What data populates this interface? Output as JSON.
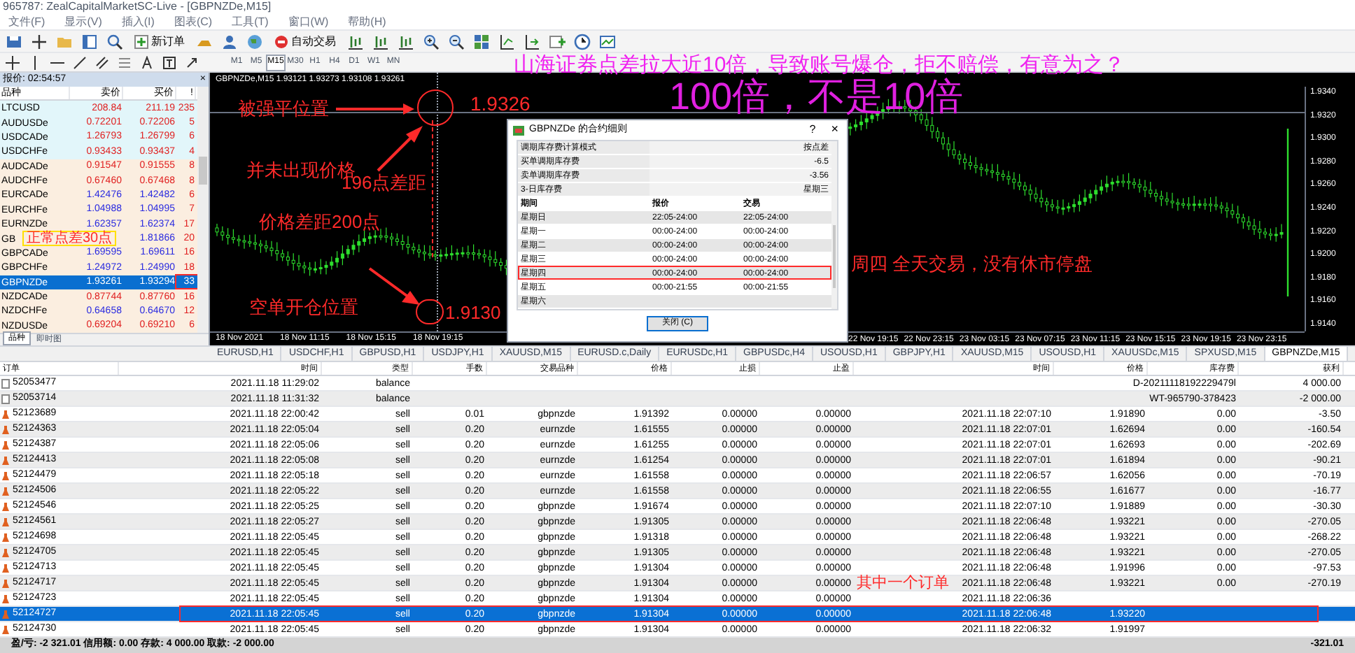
{
  "window": {
    "title": "965787: ZealCapitalMarketSC-Live - [GBPNZDe,M15]"
  },
  "menu": [
    "文件(F)",
    "显示(V)",
    "插入(I)",
    "图表(C)",
    "工具(T)",
    "窗口(W)",
    "帮助(H)"
  ],
  "toolbar": {
    "new_order": "新订单",
    "auto_trading": "自动交易"
  },
  "timeframes": [
    {
      "label": "M1",
      "selected": false
    },
    {
      "label": "M5",
      "selected": false
    },
    {
      "label": "M15",
      "selected": true
    },
    {
      "label": "M30",
      "selected": false
    },
    {
      "label": "H1",
      "selected": false
    },
    {
      "label": "H4",
      "selected": false
    },
    {
      "label": "D1",
      "selected": false
    },
    {
      "label": "W1",
      "selected": false
    },
    {
      "label": "MN",
      "selected": false
    }
  ],
  "market_watch": {
    "title": "报价: 02:54:57",
    "columns": [
      "品种",
      "卖价",
      "买价",
      "!"
    ],
    "rows": [
      {
        "symbol": "LTCUSD",
        "bid": "208.84",
        "ask": "211.19",
        "spread": "235",
        "color": "#e02020",
        "selected": false
      },
      {
        "symbol": "AUDUSDe",
        "bid": "0.72201",
        "ask": "0.72206",
        "spread": "5",
        "color": "#e02020",
        "selected": false
      },
      {
        "symbol": "USDCADe",
        "bid": "1.26793",
        "ask": "1.26799",
        "spread": "6",
        "color": "#e02020",
        "selected": false
      },
      {
        "symbol": "USDCHFe",
        "bid": "0.93433",
        "ask": "0.93437",
        "spread": "4",
        "color": "#e02020",
        "selected": false
      },
      {
        "symbol": "AUDCADe",
        "bid": "0.91547",
        "ask": "0.91555",
        "spread": "8",
        "color": "#e02020",
        "selected": false
      },
      {
        "symbol": "AUDCHFe",
        "bid": "0.67460",
        "ask": "0.67468",
        "spread": "8",
        "color": "#e02020",
        "selected": false
      },
      {
        "symbol": "EURCADe",
        "bid": "1.42476",
        "ask": "1.42482",
        "spread": "6",
        "color": "#2a2ae0",
        "selected": false
      },
      {
        "symbol": "EURCHFe",
        "bid": "1.04988",
        "ask": "1.04995",
        "spread": "7",
        "color": "#2a2ae0",
        "selected": false
      },
      {
        "symbol": "EURNZDe",
        "bid": "1.62357",
        "ask": "1.62374",
        "spread": "17",
        "color": "#2a2ae0",
        "selected": false
      },
      {
        "symbol": "GB",
        "ask": "1.81866",
        "spread": "20",
        "color": "#2a2ae0",
        "selected": false
      },
      {
        "symbol": "GBPCADe",
        "bid": "1.69595",
        "ask": "1.69611",
        "spread": "16",
        "color": "#2a2ae0",
        "selected": false
      },
      {
        "symbol": "GBPCHFe",
        "bid": "1.24972",
        "ask": "1.24990",
        "spread": "18",
        "color": "#2a2ae0",
        "selected": false
      },
      {
        "symbol": "GBPNZDe",
        "bid": "1.93261",
        "ask": "1.93294",
        "spread": "33",
        "selected": true
      },
      {
        "symbol": "NZDCADe",
        "bid": "0.87744",
        "ask": "0.87760",
        "spread": "16",
        "color": "#e02020",
        "selected": false
      },
      {
        "symbol": "NZDCHFe",
        "bid": "0.64658",
        "ask": "0.64670",
        "spread": "12",
        "color": "#2a2ae0",
        "selected": false
      },
      {
        "symbol": "NZDUSDe",
        "bid": "0.69204",
        "ask": "0.69210",
        "spread": "6",
        "color": "#e02020",
        "selected": false
      }
    ],
    "tabs": [
      {
        "label": "品种",
        "selected": true
      },
      {
        "label": "即时图",
        "selected": false
      }
    ]
  },
  "chart": {
    "header": "GBPNZDe,M15  1.93121 1.93273 1.93108 1.93261",
    "price_labels": [
      "1.9340",
      "1.9320",
      "1.9300",
      "1.9280",
      "1.9260",
      "1.9240",
      "1.9220",
      "1.9200",
      "1.9180",
      "1.9160",
      "1.9140"
    ],
    "time_labels_left": [
      "18 Nov 2021",
      "18 Nov 11:15",
      "18 Nov 15:15",
      "18 Nov 19:15"
    ],
    "time_labels_right": [
      "22 Nov 19:15",
      "22 Nov 23:15",
      "23 Nov 03:15",
      "23 Nov 07:15",
      "23 Nov 11:15",
      "23 Nov 15:15",
      "23 Nov 19:15",
      "23 Nov 23:15"
    ]
  },
  "dialog": {
    "title": "GBPNZDe 的合约细则",
    "help": "?",
    "close": "×",
    "properties": [
      {
        "name": "调期库存费计算模式",
        "value": "按点差"
      },
      {
        "name": "买单调期库存费",
        "value": "-6.5"
      },
      {
        "name": "卖单调期库存费",
        "value": "-3.56"
      },
      {
        "name": "3-日库存费",
        "value": "星期三"
      }
    ],
    "schedule_columns": [
      "期间",
      "报价",
      "交易"
    ],
    "schedule": [
      {
        "day": "星期日",
        "quote": "22:05-24:00",
        "trade": "22:05-24:00"
      },
      {
        "day": "星期一",
        "quote": "00:00-24:00",
        "trade": "00:00-24:00"
      },
      {
        "day": "星期二",
        "quote": "00:00-24:00",
        "trade": "00:00-24:00"
      },
      {
        "day": "星期三",
        "quote": "00:00-24:00",
        "trade": "00:00-24:00"
      },
      {
        "day": "星期四",
        "quote": "00:00-24:00",
        "trade": "00:00-24:00"
      },
      {
        "day": "星期五",
        "quote": "00:00-21:55",
        "trade": "00:00-21:55"
      },
      {
        "day": "星期六"
      }
    ],
    "button": "关闭 (C)"
  },
  "chart_tabs": [
    {
      "label": "EURUSD,H1",
      "selected": false
    },
    {
      "label": "USDCHF,H1",
      "selected": false
    },
    {
      "label": "GBPUSD,H1",
      "selected": false
    },
    {
      "label": "USDJPY,H1",
      "selected": false
    },
    {
      "label": "XAUUSD,M15",
      "selected": false
    },
    {
      "label": "EURUSD.c,Daily",
      "selected": false
    },
    {
      "label": "EURUSDc,H1",
      "selected": false
    },
    {
      "label": "GBPUSDc,H4",
      "selected": false
    },
    {
      "label": "USOUSD,H1",
      "selected": false
    },
    {
      "label": "GBPJPY,H1",
      "selected": false
    },
    {
      "label": "XAUUSD,M15",
      "selected": false
    },
    {
      "label": "USOUSD,H1",
      "selected": false
    },
    {
      "label": "XAUUSDc,M15",
      "selected": false
    },
    {
      "label": "SPXUSD,M15",
      "selected": false
    },
    {
      "label": "GBPNZDe,M15",
      "selected": true
    }
  ],
  "history": {
    "columns": [
      "订单",
      "时间",
      "类型",
      "手数",
      "交易品种",
      "价格",
      "止损",
      "止盈",
      "时间",
      "价格",
      "库存费",
      "获利"
    ],
    "rows": [
      {
        "kind": "balance",
        "order": "52053477",
        "time": "2021.11.18 11:29:02",
        "type": "balance",
        "comment": "D-20211118192229479l",
        "profit": "4 000.00",
        "selected": false
      },
      {
        "kind": "balance",
        "order": "52053714",
        "time": "2021.11.18 11:31:32",
        "type": "balance",
        "comment": "WT-965790-378423",
        "profit": "-2 000.00",
        "selected": false
      },
      {
        "kind": "trade",
        "order": "52123689",
        "time": "2021.11.18 22:00:42",
        "type": "sell",
        "lots": "0.01",
        "symbol": "gbpnzde",
        "price": "1.91392",
        "sl": "0.00000",
        "tp": "0.00000",
        "close_time": "2021.11.18 22:07:10",
        "close_price": "1.91890",
        "swap": "0.00",
        "profit": "-3.50",
        "selected": false
      },
      {
        "kind": "trade",
        "order": "52124363",
        "time": "2021.11.18 22:05:04",
        "type": "sell",
        "lots": "0.20",
        "symbol": "eurnzde",
        "price": "1.61555",
        "sl": "0.00000",
        "tp": "0.00000",
        "close_time": "2021.11.18 22:07:01",
        "close_price": "1.62694",
        "swap": "0.00",
        "profit": "-160.54",
        "selected": false
      },
      {
        "kind": "trade",
        "order": "52124387",
        "time": "2021.11.18 22:05:06",
        "type": "sell",
        "lots": "0.20",
        "symbol": "eurnzde",
        "price": "1.61255",
        "sl": "0.00000",
        "tp": "0.00000",
        "close_time": "2021.11.18 22:07:01",
        "close_price": "1.62693",
        "swap": "0.00",
        "profit": "-202.69",
        "selected": false
      },
      {
        "kind": "trade",
        "order": "52124413",
        "time": "2021.11.18 22:05:08",
        "type": "sell",
        "lots": "0.20",
        "symbol": "eurnzde",
        "price": "1.61254",
        "sl": "0.00000",
        "tp": "0.00000",
        "close_time": "2021.11.18 22:07:01",
        "close_price": "1.61894",
        "swap": "0.00",
        "profit": "-90.21",
        "selected": false
      },
      {
        "kind": "trade",
        "order": "52124479",
        "time": "2021.11.18 22:05:18",
        "type": "sell",
        "lots": "0.20",
        "symbol": "eurnzde",
        "price": "1.61558",
        "sl": "0.00000",
        "tp": "0.00000",
        "close_time": "2021.11.18 22:06:57",
        "close_price": "1.62056",
        "swap": "0.00",
        "profit": "-70.19",
        "selected": false
      },
      {
        "kind": "trade",
        "order": "52124506",
        "time": "2021.11.18 22:05:22",
        "type": "sell",
        "lots": "0.20",
        "symbol": "eurnzde",
        "price": "1.61558",
        "sl": "0.00000",
        "tp": "0.00000",
        "close_time": "2021.11.18 22:06:55",
        "close_price": "1.61677",
        "swap": "0.00",
        "profit": "-16.77",
        "selected": false
      },
      {
        "kind": "trade",
        "order": "52124546",
        "time": "2021.11.18 22:05:25",
        "type": "sell",
        "lots": "0.20",
        "symbol": "gbpnzde",
        "price": "1.91674",
        "sl": "0.00000",
        "tp": "0.00000",
        "close_time": "2021.11.18 22:07:10",
        "close_price": "1.91889",
        "swap": "0.00",
        "profit": "-30.30",
        "selected": false
      },
      {
        "kind": "trade",
        "order": "52124561",
        "time": "2021.11.18 22:05:27",
        "type": "sell",
        "lots": "0.20",
        "symbol": "gbpnzde",
        "price": "1.91305",
        "sl": "0.00000",
        "tp": "0.00000",
        "close_time": "2021.11.18 22:06:48",
        "close_price": "1.93221",
        "swap": "0.00",
        "profit": "-270.05",
        "selected": false
      },
      {
        "kind": "trade",
        "order": "52124698",
        "time": "2021.11.18 22:05:45",
        "type": "sell",
        "lots": "0.20",
        "symbol": "gbpnzde",
        "price": "1.91318",
        "sl": "0.00000",
        "tp": "0.00000",
        "close_time": "2021.11.18 22:06:48",
        "close_price": "1.93221",
        "swap": "0.00",
        "profit": "-268.22",
        "selected": false
      },
      {
        "kind": "trade",
        "order": "52124705",
        "time": "2021.11.18 22:05:45",
        "type": "sell",
        "lots": "0.20",
        "symbol": "gbpnzde",
        "price": "1.91305",
        "sl": "0.00000",
        "tp": "0.00000",
        "close_time": "2021.11.18 22:06:48",
        "close_price": "1.93221",
        "swap": "0.00",
        "profit": "-270.05",
        "selected": false
      },
      {
        "kind": "trade",
        "order": "52124713",
        "time": "2021.11.18 22:05:45",
        "type": "sell",
        "lots": "0.20",
        "symbol": "gbpnzde",
        "price": "1.91304",
        "sl": "0.00000",
        "tp": "0.00000",
        "close_time": "2021.11.18 22:06:48",
        "close_price": "1.91996",
        "swap": "0.00",
        "profit": "-97.53",
        "selected": false
      },
      {
        "kind": "trade",
        "order": "52124717",
        "time": "2021.11.18 22:05:45",
        "type": "sell",
        "lots": "0.20",
        "symbol": "gbpnzde",
        "price": "1.91304",
        "sl": "0.00000",
        "tp": "0.00000",
        "close_time": "2021.11.18 22:06:48",
        "close_price": "1.93221",
        "swap": "0.00",
        "profit": "-270.19",
        "selected": false
      },
      {
        "kind": "trade",
        "order": "52124723",
        "time": "2021.11.18 22:05:45",
        "type": "sell",
        "lots": "0.20",
        "symbol": "gbpnzde",
        "price": "1.91304",
        "sl": "0.00000",
        "tp": "0.00000",
        "close_time": "2021.11.18 22:06:36",
        "selected": false
      },
      {
        "kind": "trade",
        "order": "52124727",
        "time": "2021.11.18 22:05:45",
        "type": "sell",
        "lots": "0.20",
        "symbol": "gbpnzde",
        "price": "1.91304",
        "sl": "0.00000",
        "tp": "0.00000",
        "close_time": "2021.11.18 22:06:48",
        "close_price": "1.93220",
        "selected": true
      },
      {
        "kind": "trade",
        "order": "52124730",
        "time": "2021.11.18 22:05:45",
        "type": "sell",
        "lots": "0.20",
        "symbol": "gbpnzde",
        "price": "1.91304",
        "sl": "0.00000",
        "tp": "0.00000",
        "close_time": "2021.11.18 22:06:32",
        "close_price": "1.91997",
        "selected": false
      }
    ],
    "summary": "盈/亏: -2 321.01  信用额: 0.00  存款: 4 000.00  取款: -2 000.00",
    "total": "-321.01"
  },
  "annotations": [
    {
      "kind": "headline",
      "text": "山海证券点差拉大近10倍，导致账号爆仓，拒不赔偿，有意为之？"
    },
    {
      "kind": "label",
      "text": "被强平位置"
    },
    {
      "kind": "price",
      "text": "1.9326"
    },
    {
      "kind": "big",
      "text": "100倍，不是10倍"
    },
    {
      "kind": "label",
      "text": "并未出现价格"
    },
    {
      "kind": "label",
      "text": "196点差距"
    },
    {
      "kind": "label",
      "text": "价格差距200点"
    },
    {
      "kind": "boxed",
      "text": "正常点差30点"
    },
    {
      "kind": "label",
      "text": "周四 全天交易，没有休市停盘"
    },
    {
      "kind": "label",
      "text": "空单开仓位置"
    },
    {
      "kind": "price",
      "text": "1.9130"
    },
    {
      "kind": "label",
      "text": "其中一个订单"
    }
  ]
}
